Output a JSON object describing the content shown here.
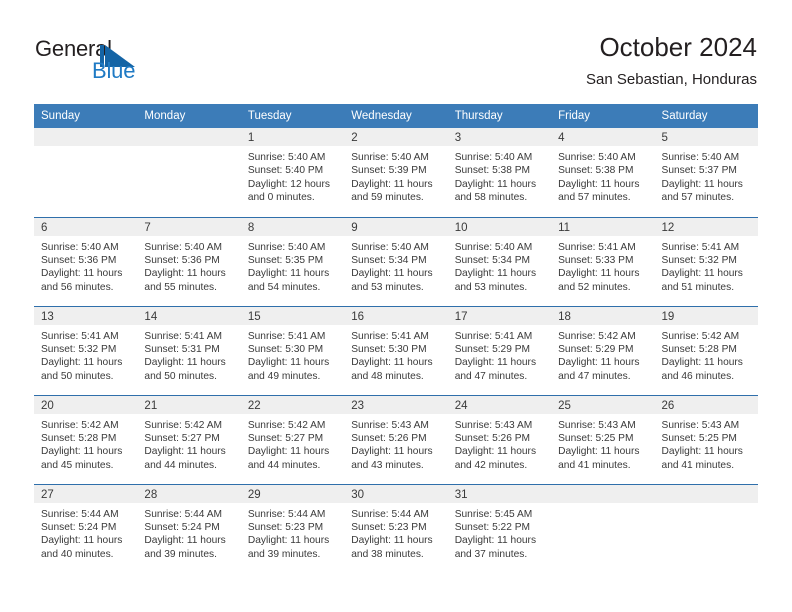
{
  "brand": {
    "name_part1": "General",
    "name_part2": "Blue",
    "accent_color": "#1464a5",
    "logo_icon": "triangle-flag-icon"
  },
  "header": {
    "title": "October 2024",
    "subtitle": "San Sebastian, Honduras"
  },
  "calendar": {
    "header_bg": "#3c7cb8",
    "daynum_bg": "#efefef",
    "row_divider_color": "#2f6fab",
    "weekday_headers": [
      "Sunday",
      "Monday",
      "Tuesday",
      "Wednesday",
      "Thursday",
      "Friday",
      "Saturday"
    ],
    "weeks": [
      [
        {
          "day": "",
          "lines": []
        },
        {
          "day": "",
          "lines": []
        },
        {
          "day": "1",
          "lines": [
            "Sunrise: 5:40 AM",
            "Sunset: 5:40 PM",
            "Daylight: 12 hours",
            "and 0 minutes."
          ]
        },
        {
          "day": "2",
          "lines": [
            "Sunrise: 5:40 AM",
            "Sunset: 5:39 PM",
            "Daylight: 11 hours",
            "and 59 minutes."
          ]
        },
        {
          "day": "3",
          "lines": [
            "Sunrise: 5:40 AM",
            "Sunset: 5:38 PM",
            "Daylight: 11 hours",
            "and 58 minutes."
          ]
        },
        {
          "day": "4",
          "lines": [
            "Sunrise: 5:40 AM",
            "Sunset: 5:38 PM",
            "Daylight: 11 hours",
            "and 57 minutes."
          ]
        },
        {
          "day": "5",
          "lines": [
            "Sunrise: 5:40 AM",
            "Sunset: 5:37 PM",
            "Daylight: 11 hours",
            "and 57 minutes."
          ]
        }
      ],
      [
        {
          "day": "6",
          "lines": [
            "Sunrise: 5:40 AM",
            "Sunset: 5:36 PM",
            "Daylight: 11 hours",
            "and 56 minutes."
          ]
        },
        {
          "day": "7",
          "lines": [
            "Sunrise: 5:40 AM",
            "Sunset: 5:36 PM",
            "Daylight: 11 hours",
            "and 55 minutes."
          ]
        },
        {
          "day": "8",
          "lines": [
            "Sunrise: 5:40 AM",
            "Sunset: 5:35 PM",
            "Daylight: 11 hours",
            "and 54 minutes."
          ]
        },
        {
          "day": "9",
          "lines": [
            "Sunrise: 5:40 AM",
            "Sunset: 5:34 PM",
            "Daylight: 11 hours",
            "and 53 minutes."
          ]
        },
        {
          "day": "10",
          "lines": [
            "Sunrise: 5:40 AM",
            "Sunset: 5:34 PM",
            "Daylight: 11 hours",
            "and 53 minutes."
          ]
        },
        {
          "day": "11",
          "lines": [
            "Sunrise: 5:41 AM",
            "Sunset: 5:33 PM",
            "Daylight: 11 hours",
            "and 52 minutes."
          ]
        },
        {
          "day": "12",
          "lines": [
            "Sunrise: 5:41 AM",
            "Sunset: 5:32 PM",
            "Daylight: 11 hours",
            "and 51 minutes."
          ]
        }
      ],
      [
        {
          "day": "13",
          "lines": [
            "Sunrise: 5:41 AM",
            "Sunset: 5:32 PM",
            "Daylight: 11 hours",
            "and 50 minutes."
          ]
        },
        {
          "day": "14",
          "lines": [
            "Sunrise: 5:41 AM",
            "Sunset: 5:31 PM",
            "Daylight: 11 hours",
            "and 50 minutes."
          ]
        },
        {
          "day": "15",
          "lines": [
            "Sunrise: 5:41 AM",
            "Sunset: 5:30 PM",
            "Daylight: 11 hours",
            "and 49 minutes."
          ]
        },
        {
          "day": "16",
          "lines": [
            "Sunrise: 5:41 AM",
            "Sunset: 5:30 PM",
            "Daylight: 11 hours",
            "and 48 minutes."
          ]
        },
        {
          "day": "17",
          "lines": [
            "Sunrise: 5:41 AM",
            "Sunset: 5:29 PM",
            "Daylight: 11 hours",
            "and 47 minutes."
          ]
        },
        {
          "day": "18",
          "lines": [
            "Sunrise: 5:42 AM",
            "Sunset: 5:29 PM",
            "Daylight: 11 hours",
            "and 47 minutes."
          ]
        },
        {
          "day": "19",
          "lines": [
            "Sunrise: 5:42 AM",
            "Sunset: 5:28 PM",
            "Daylight: 11 hours",
            "and 46 minutes."
          ]
        }
      ],
      [
        {
          "day": "20",
          "lines": [
            "Sunrise: 5:42 AM",
            "Sunset: 5:28 PM",
            "Daylight: 11 hours",
            "and 45 minutes."
          ]
        },
        {
          "day": "21",
          "lines": [
            "Sunrise: 5:42 AM",
            "Sunset: 5:27 PM",
            "Daylight: 11 hours",
            "and 44 minutes."
          ]
        },
        {
          "day": "22",
          "lines": [
            "Sunrise: 5:42 AM",
            "Sunset: 5:27 PM",
            "Daylight: 11 hours",
            "and 44 minutes."
          ]
        },
        {
          "day": "23",
          "lines": [
            "Sunrise: 5:43 AM",
            "Sunset: 5:26 PM",
            "Daylight: 11 hours",
            "and 43 minutes."
          ]
        },
        {
          "day": "24",
          "lines": [
            "Sunrise: 5:43 AM",
            "Sunset: 5:26 PM",
            "Daylight: 11 hours",
            "and 42 minutes."
          ]
        },
        {
          "day": "25",
          "lines": [
            "Sunrise: 5:43 AM",
            "Sunset: 5:25 PM",
            "Daylight: 11 hours",
            "and 41 minutes."
          ]
        },
        {
          "day": "26",
          "lines": [
            "Sunrise: 5:43 AM",
            "Sunset: 5:25 PM",
            "Daylight: 11 hours",
            "and 41 minutes."
          ]
        }
      ],
      [
        {
          "day": "27",
          "lines": [
            "Sunrise: 5:44 AM",
            "Sunset: 5:24 PM",
            "Daylight: 11 hours",
            "and 40 minutes."
          ]
        },
        {
          "day": "28",
          "lines": [
            "Sunrise: 5:44 AM",
            "Sunset: 5:24 PM",
            "Daylight: 11 hours",
            "and 39 minutes."
          ]
        },
        {
          "day": "29",
          "lines": [
            "Sunrise: 5:44 AM",
            "Sunset: 5:23 PM",
            "Daylight: 11 hours",
            "and 39 minutes."
          ]
        },
        {
          "day": "30",
          "lines": [
            "Sunrise: 5:44 AM",
            "Sunset: 5:23 PM",
            "Daylight: 11 hours",
            "and 38 minutes."
          ]
        },
        {
          "day": "31",
          "lines": [
            "Sunrise: 5:45 AM",
            "Sunset: 5:22 PM",
            "Daylight: 11 hours",
            "and 37 minutes."
          ]
        },
        {
          "day": "",
          "lines": []
        },
        {
          "day": "",
          "lines": []
        }
      ]
    ]
  }
}
